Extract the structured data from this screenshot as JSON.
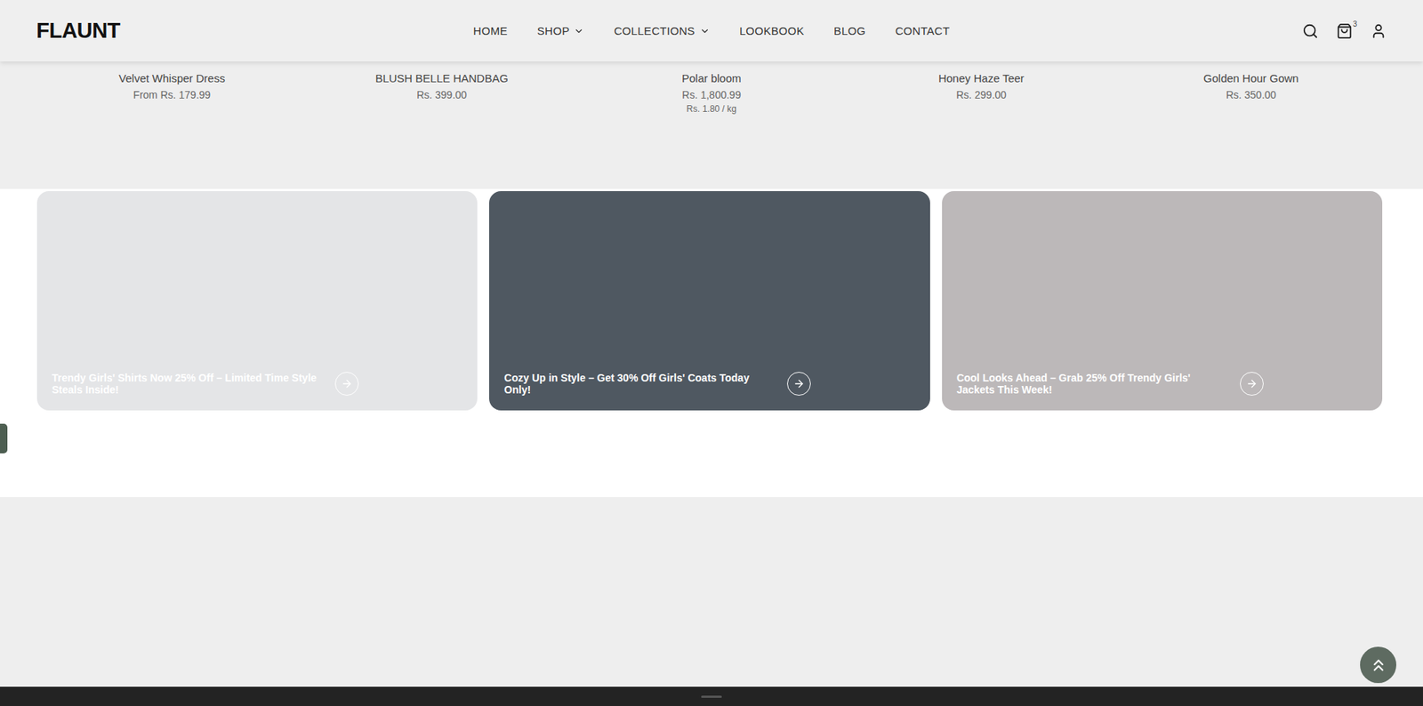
{
  "header": {
    "logo": "FLAUNT",
    "nav": [
      {
        "label": "HOME",
        "dropdown": false
      },
      {
        "label": "SHOP",
        "dropdown": true
      },
      {
        "label": "COLLECTIONS",
        "dropdown": true
      },
      {
        "label": "LOOKBOOK",
        "dropdown": false
      },
      {
        "label": "BLOG",
        "dropdown": false
      },
      {
        "label": "CONTACT",
        "dropdown": false
      }
    ],
    "cart_count": "3"
  },
  "products": [
    {
      "name": "Velvet Whisper Dress",
      "price": "From Rs. 179.99",
      "unit_price": ""
    },
    {
      "name": "BLUSH BELLE HANDBAG",
      "price": "Rs. 399.00",
      "unit_price": ""
    },
    {
      "name": "Polar bloom",
      "price": "Rs. 1,800.99",
      "unit_price": "Rs. 1.80 / kg"
    },
    {
      "name": "Honey Haze Teer",
      "price": "Rs. 299.00",
      "unit_price": ""
    },
    {
      "name": "Golden Hour Gown",
      "price": "Rs. 350.00",
      "unit_price": ""
    }
  ],
  "banners": [
    {
      "caption": "Trendy Girls' Shirts Now 25% Off – Limited Time Style Steals Inside!",
      "color": "#e4e5e7"
    },
    {
      "caption": "Cozy Up in Style – Get 30% Off Girls' Coats Today Only!",
      "color": "#4f5861"
    },
    {
      "caption": "Cool Looks Ahead – Grab 25% Off Trendy Girls' Jackets This Week!",
      "color": "#bcb8b9"
    }
  ]
}
